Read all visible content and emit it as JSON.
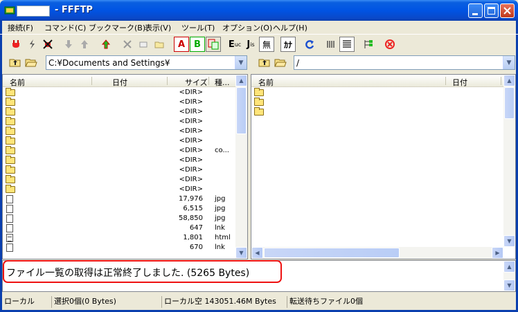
{
  "window": {
    "title": "- FFFTP",
    "host_value": ""
  },
  "menu": [
    "接続(F)",
    "コマンド(C)",
    "ブックマーク(B)",
    "表示(V)",
    "ツール(T)",
    "オプション(O)",
    "ヘルプ(H)"
  ],
  "toolbar": {
    "icons": [
      "connect-icon",
      "quick-connect-icon",
      "disconnect-icon",
      "download-icon",
      "upload-icon",
      "mirror-upload-icon",
      "delete-icon",
      "rename-icon",
      "mkdir-icon",
      "ascii-mode-icon",
      "binary-mode-icon",
      "auto-mode-icon",
      "euc-icon",
      "jis-icon",
      "no-convert-icon",
      "kana-icon",
      "refresh-icon",
      "list-view-icon",
      "detail-view-icon",
      "sync-icon",
      "stop-icon"
    ],
    "labels": {
      "ascii": "A",
      "binary": "B",
      "euc": "E",
      "euc_sub": "uc",
      "jis": "J",
      "jis_sub": "is",
      "no_convert": "無",
      "kana": "ｶﾅ"
    }
  },
  "local": {
    "path": "C:¥Documents and Settings¥",
    "columns": {
      "name": "名前",
      "date": "日付",
      "size": "サイズ",
      "type": "種..."
    },
    "rows": [
      {
        "kind": "folder",
        "size": "<DIR>",
        "type": ""
      },
      {
        "kind": "folder",
        "size": "<DIR>",
        "type": ""
      },
      {
        "kind": "folder",
        "size": "<DIR>",
        "type": ""
      },
      {
        "kind": "folder",
        "size": "<DIR>",
        "type": ""
      },
      {
        "kind": "folder",
        "size": "<DIR>",
        "type": ""
      },
      {
        "kind": "folder",
        "size": "<DIR>",
        "type": ""
      },
      {
        "kind": "folder",
        "size": "<DIR>",
        "type": "co..."
      },
      {
        "kind": "folder",
        "size": "<DIR>",
        "type": ""
      },
      {
        "kind": "folder",
        "size": "<DIR>",
        "type": ""
      },
      {
        "kind": "folder",
        "size": "<DIR>",
        "type": ""
      },
      {
        "kind": "folder",
        "size": "<DIR>",
        "type": ""
      },
      {
        "kind": "file",
        "size": "17,976",
        "type": "jpg"
      },
      {
        "kind": "file",
        "size": "6,515",
        "type": "jpg"
      },
      {
        "kind": "file",
        "size": "58,850",
        "type": "jpg"
      },
      {
        "kind": "file",
        "size": "647",
        "type": "lnk"
      },
      {
        "kind": "doc",
        "size": "1,801",
        "type": "html"
      },
      {
        "kind": "file",
        "size": "670",
        "type": "lnk"
      }
    ]
  },
  "remote": {
    "path": "/",
    "columns": {
      "name": "名前",
      "date": "日付"
    },
    "rows": [
      {
        "kind": "folder"
      },
      {
        "kind": "folder"
      },
      {
        "kind": "folder"
      }
    ]
  },
  "log": {
    "message": "ファイル一覧の取得は正常終了しました. (5265 Bytes)"
  },
  "status": {
    "mode": "ローカル",
    "selection": "選択0個(0 Bytes)",
    "free_space": "ローカル空 143051.46M Bytes",
    "queue": "転送待ちファイル0個"
  },
  "colors": {
    "titlebar": "#0054e3",
    "highlight": "#e11111",
    "face": "#ece9d8"
  }
}
